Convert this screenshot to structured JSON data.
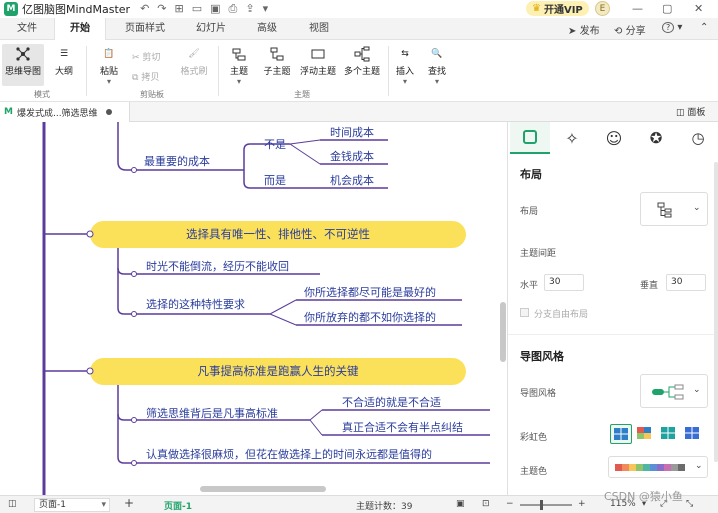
{
  "app": {
    "name": "亿图脑图MindMaster",
    "vip_label": "开通VIP",
    "avatar_letter": "E"
  },
  "menu": {
    "tabs": [
      "文件",
      "开始",
      "页面样式",
      "幻灯片",
      "高级",
      "视图"
    ],
    "active_tab": "开始",
    "publish": "发布",
    "share": "分享",
    "help": "?"
  },
  "ribbon": {
    "mode": {
      "mindmap": "思维导图",
      "outline": "大纲",
      "group": "模式"
    },
    "clipboard": {
      "paste": "粘贴",
      "cut": "剪切",
      "copy": "拷贝",
      "format_brush": "格式刷",
      "group": "剪贴板"
    },
    "topic": {
      "topic": "主题",
      "subtopic": "子主题",
      "floating": "浮动主题",
      "multi": "多个主题",
      "group": "主题"
    },
    "insert": "插入",
    "find": "查找"
  },
  "doc_tab": {
    "title": "爆发式成...筛选思维",
    "panel_toggle": "面板"
  },
  "mindmap": {
    "block1": {
      "topic": "最重要的成本",
      "branches": [
        {
          "label": "不是",
          "leaves": [
            "时间成本",
            "金钱成本"
          ]
        },
        {
          "label": "而是",
          "leaves": [
            "机会成本"
          ]
        }
      ]
    },
    "block2": {
      "topic": "选择具有唯一性、排他性、不可逆性",
      "sub1": "时光不能倒流，经历不能收回",
      "sub2": "选择的这种特性要求",
      "sub2_leaves": [
        "你所选择都尽可能是最好的",
        "你所放弃的都不如你选择的"
      ]
    },
    "block3": {
      "topic": "凡事提高标准是跑赢人生的关键",
      "sub1": "筛选思维背后是凡事高标准",
      "sub1_leaves": [
        "不合适的就是不合适",
        "真正合适不会有半点纠结"
      ],
      "sub2": "认真做选择很麻烦，但花在做选择上的时间永远都是值得的"
    }
  },
  "panel": {
    "layout_title": "布局",
    "layout_label": "布局",
    "spacing_label": "主题间距",
    "horizontal_label": "水平",
    "horizontal_value": "30",
    "vertical_label": "垂直",
    "vertical_value": "30",
    "free_layout": "分支自由布局",
    "style_title": "导图风格",
    "style_label": "导图风格",
    "rainbow_label": "彩虹色",
    "theme_color_label": "主题色",
    "theme_colors": [
      "#e05a4f",
      "#f28b5b",
      "#f6c65b",
      "#8fc46a",
      "#4fb5a5",
      "#5b8fd6",
      "#8a6cc9",
      "#c76fb0",
      "#9a9a9a",
      "#6b6b6b"
    ]
  },
  "status": {
    "page_select": "页面-1",
    "page_tab": "页面-1",
    "topic_count": "主题计数：39",
    "zoom": "115%",
    "watermark": "CSDN @猿小鱼"
  },
  "colors": {
    "accent": "#1fa36a",
    "topic_yellow": "#fbe15a",
    "line_purple": "#5b3c9c",
    "text_blue": "#2a3c9c"
  }
}
